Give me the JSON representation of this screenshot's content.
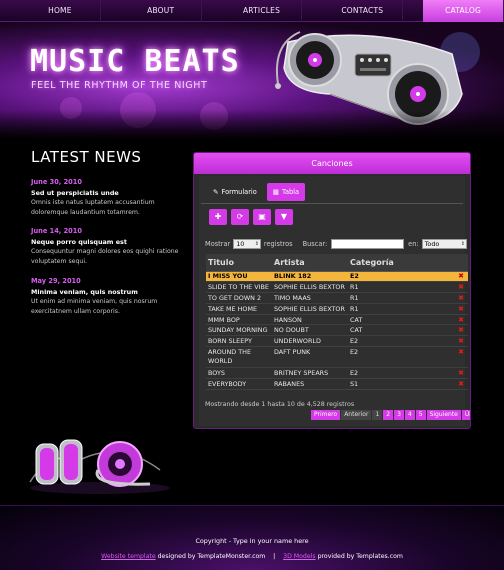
{
  "nav": [
    {
      "label": "HOME",
      "active": false
    },
    {
      "label": "ABOUT",
      "active": false
    },
    {
      "label": "ARTICLES",
      "active": false
    },
    {
      "label": "CONTACTS",
      "active": false
    },
    {
      "label": "CATALOG",
      "active": true
    }
  ],
  "header": {
    "title": "MUSIC BEATS",
    "tagline": "FEEL THE RHYTHM OF THE NIGHT"
  },
  "news": {
    "title": "LATEST NEWS",
    "items": [
      {
        "date": "June 30, 2010",
        "headline": "Sed ut perspiciatis unde",
        "body": "Omnis iste natus luptatem accusantium doloremque laudantium totamrem."
      },
      {
        "date": "June 14, 2010",
        "headline": "Neque porro quisquam est",
        "body": "Consequuntur magni dolores eos quighi ratione voluptatem sequi."
      },
      {
        "date": "May 29, 2010",
        "headline": "Minima veniam, quis nostrum",
        "body": "Ut enim ad minima veniam, quis nosrum exercitatnem ullam corporis."
      }
    ]
  },
  "panel": {
    "title": "Canciones",
    "tabs": [
      {
        "label": "Formulario",
        "icon": "pencil-icon",
        "active": false
      },
      {
        "label": "Tabla",
        "icon": "table-icon",
        "active": true
      }
    ],
    "toolbar": [
      {
        "name": "add-button",
        "icon": "plus-icon",
        "glyph": "✚"
      },
      {
        "name": "refresh-button",
        "icon": "refresh-icon",
        "glyph": "⟳"
      },
      {
        "name": "print-button",
        "icon": "print-icon",
        "glyph": "▣"
      },
      {
        "name": "filter-button",
        "icon": "filter-icon",
        "glyph": "▼"
      }
    ],
    "filter": {
      "show_label": "Mostrar",
      "show_value": "10",
      "records_label": "registros",
      "search_label": "Buscar:",
      "search_value": "",
      "in_label": "en:",
      "in_value": "Todo"
    },
    "columns": [
      "Titulo",
      "Artista",
      "Categoría"
    ],
    "rows": [
      {
        "titulo": "I MISS YOU",
        "artista": "BLINK 182",
        "categoria": "E2",
        "selected": true,
        "delete": true
      },
      {
        "titulo": "SLIDE TO THE VIBE",
        "artista": "SOPHIE ELLIS BEXTOR",
        "categoria": "R1",
        "delete": true
      },
      {
        "titulo": "TO GET DOWN 2",
        "artista": "TIMO MAAS",
        "categoria": "R1",
        "delete": true
      },
      {
        "titulo": "TAKE ME HOME",
        "artista": "SOPHIE ELLIS BEXTOR",
        "categoria": "R1",
        "delete": true
      },
      {
        "titulo": "MMM BOP",
        "artista": "HANSON",
        "categoria": "CAT",
        "delete": true
      },
      {
        "titulo": "SUNDAY MORNING",
        "artista": "NO DOUBT",
        "categoria": "CAT",
        "delete": true
      },
      {
        "titulo": "BORN SLEEPY",
        "artista": "UNDERWORLD",
        "categoria": "E2",
        "delete": true
      },
      {
        "titulo": "AROUND THE WORLD",
        "artista": "DAFT PUNK",
        "categoria": "E2",
        "delete": true,
        "tall": true
      },
      {
        "titulo": "BOYS",
        "artista": "BRITNEY SPEARS",
        "categoria": "E2",
        "delete": true
      },
      {
        "titulo": "EVERYBODY",
        "artista": "RABANES",
        "categoria": "S1",
        "delete": true
      }
    ],
    "info": "Mostrando desde 1 hasta 10 de 4,528 registros",
    "pager": [
      "Primero",
      "Anterior",
      "1",
      "2",
      "3",
      "4",
      "5",
      "Siguiente",
      "Último"
    ],
    "pager_active": "1"
  },
  "footer": {
    "copyright": "Copyright - Type in your name here",
    "link1": "Website template",
    "text1": " designed by TemplateMonster.com",
    "sep": "|",
    "link2": "3D Models",
    "text2": " provided by Templates.com"
  },
  "colors": {
    "accent": "#d43ae8",
    "selected_row": "#f4b53b",
    "delete": "#e21b1b",
    "news_date": "#d95cf0"
  }
}
